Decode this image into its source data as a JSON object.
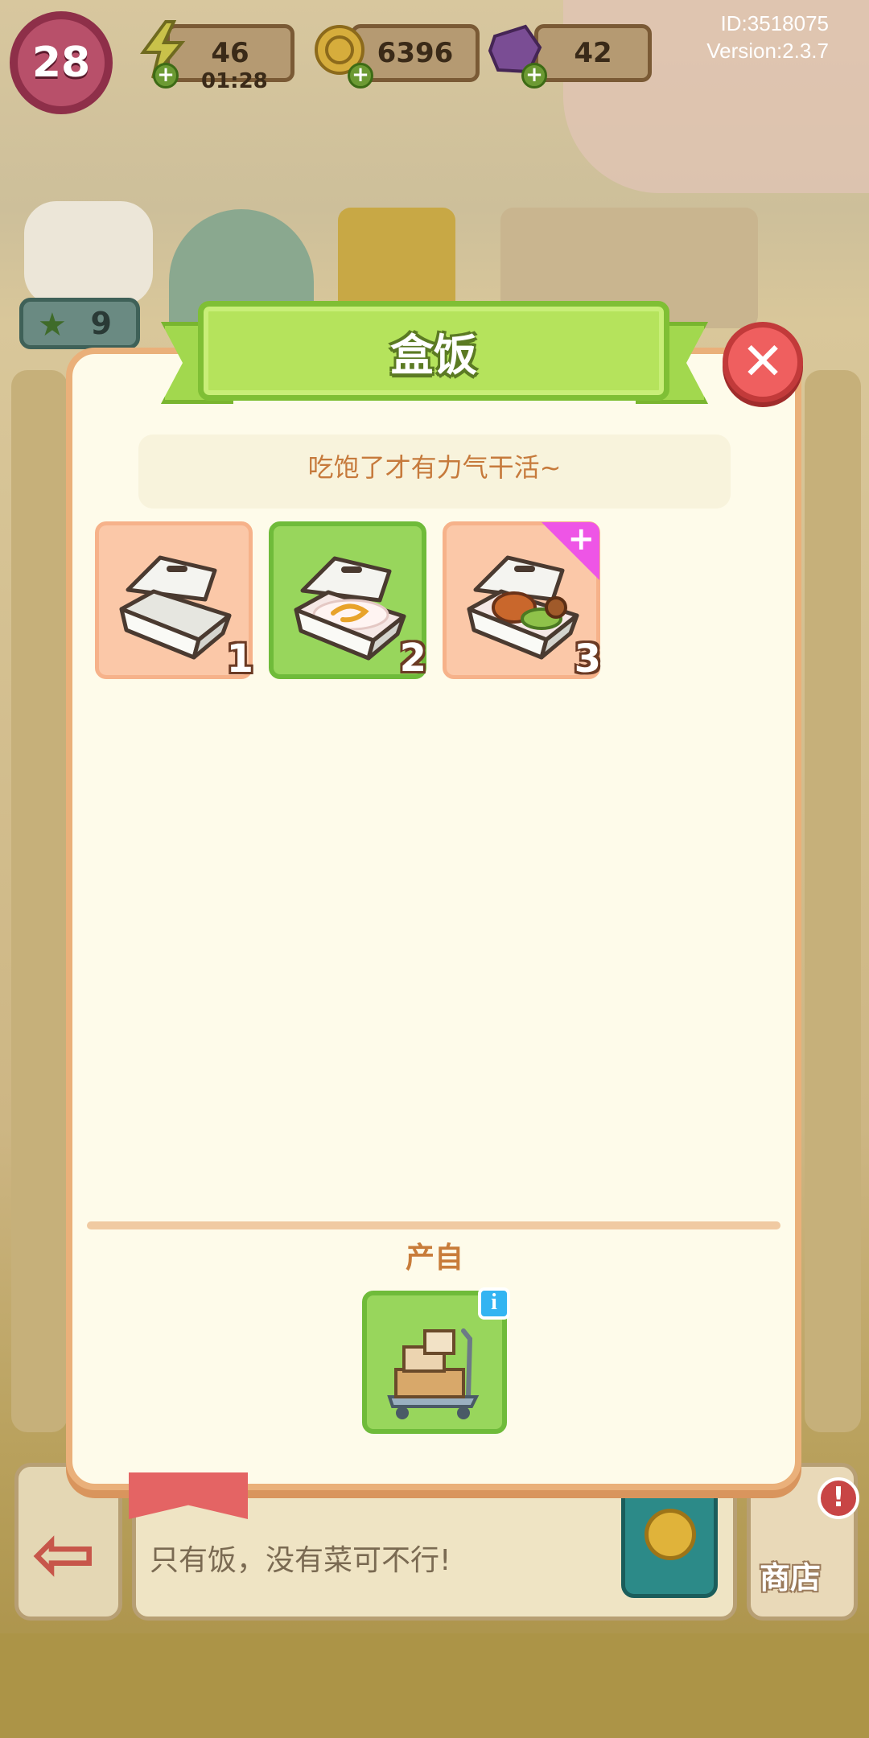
{
  "hud": {
    "player_level": "28",
    "energy": "46",
    "energy_timer": "01:28",
    "coins": "6396",
    "gems": "42",
    "player_id": "ID:3518075",
    "version": "Version:2.3.7"
  },
  "background": {
    "star_count": "9"
  },
  "dialog": {
    "title": "盒饭",
    "description": "吃饱了才有力气干活~",
    "close_icon": "close-icon",
    "items": [
      {
        "level": "1",
        "icon": "empty-lunchbox-icon",
        "state": "unlocked"
      },
      {
        "level": "2",
        "icon": "rice-lunchbox-icon",
        "state": "current"
      },
      {
        "level": "3",
        "icon": "meat-lunchbox-icon",
        "state": "unlocked",
        "badge": "plus-badge"
      }
    ],
    "source_label": "产自",
    "source_icon": "delivery-cart-icon"
  },
  "bottom_bar": {
    "message": "只有饭，没有菜可不行!",
    "shop_label": "商店",
    "shop_alert": "!"
  },
  "colors": {
    "ribbon_green": "#b5e35c",
    "tile_peach": "#fbc8a8",
    "tile_green": "#98d65c",
    "close_red": "#ef5f5f",
    "text_orange": "#c67a3c"
  }
}
